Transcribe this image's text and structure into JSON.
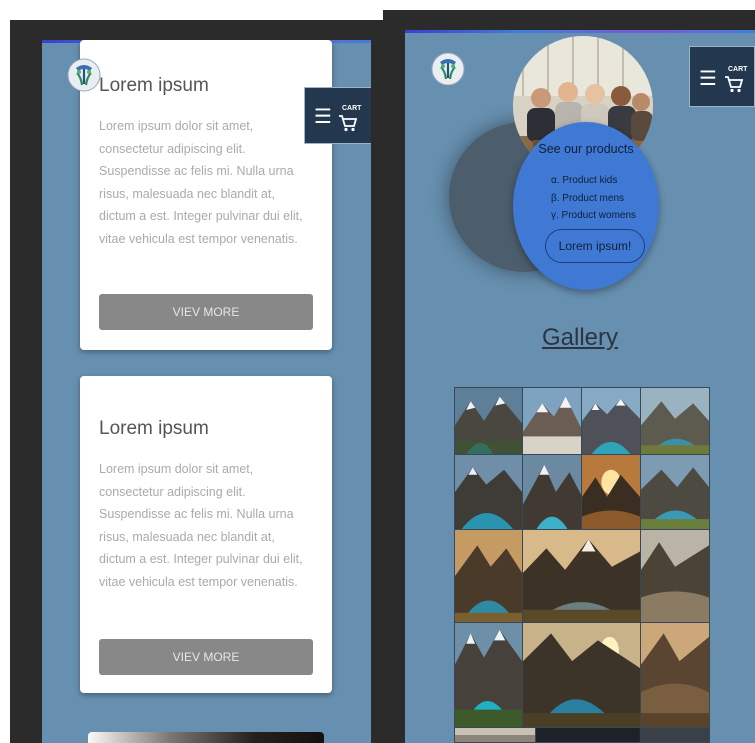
{
  "left_panel": {
    "cart_label": "CART",
    "menu_icon": "☰",
    "cards": [
      {
        "title": "Lorem ipsum",
        "text": "Lorem ipsum dolor sit amet, consectetur adipiscing elit. Suspendisse ac felis mi. Nulla urna risus, malesuada nec blandit at, dictum a est. Integer pulvinar dui elit, vitae vehicula est tempor venenatis.",
        "button": "VIEV MORE"
      },
      {
        "title": "Lorem ipsum",
        "text": "Lorem ipsum dolor sit amet, consectetur adipiscing elit. Suspendisse ac felis mi. Nulla urna risus, malesuada nec blandit at, dictum a est. Integer pulvinar dui elit, vitae vehicula est tempor venenatis.",
        "button": "VIEV MORE"
      }
    ]
  },
  "right_panel": {
    "cart_label": "CART",
    "menu_icon": "☰",
    "products": {
      "title": "See our products",
      "items": [
        "α. Product kids",
        "β. Product mens",
        "γ. Product womens"
      ],
      "button": "Lorem ipsum!"
    },
    "gallery_title": "Gallery"
  },
  "colors": {
    "screen_bg": "#6790b0",
    "frame_bg": "#2b2b2b",
    "menu_button": "#23384f",
    "products_circle": "#3f79d4",
    "card_button": "#888888"
  },
  "icons": [
    "logo-icon",
    "hamburger-icon",
    "cart-icon"
  ]
}
